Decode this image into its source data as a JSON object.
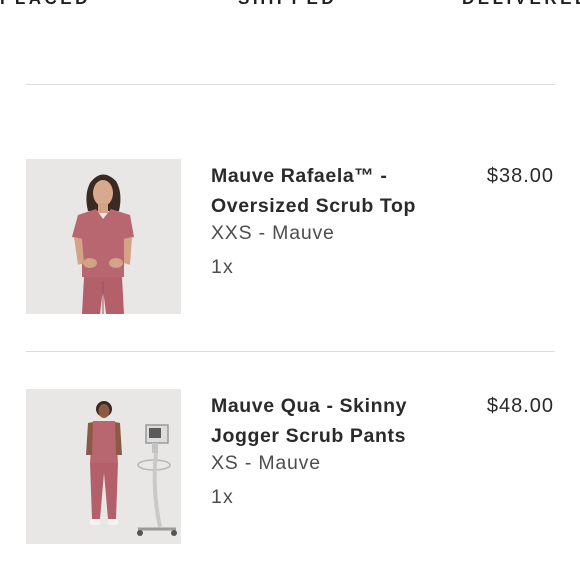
{
  "status_steps": [
    "PLACED",
    "SHIPPED",
    "DELIVERED"
  ],
  "items": [
    {
      "name": "Mauve Rafaela™ - Oversized Scrub Top",
      "variant": "XXS - Mauve",
      "quantity": "1x",
      "price": "$38.00",
      "image_icon": "scrub-top-photo-icon"
    },
    {
      "name": "Mauve Qua - Skinny Jogger Scrub Pants",
      "variant": "XS - Mauve",
      "quantity": "1x",
      "price": "$48.00",
      "image_icon": "scrub-pants-photo-icon"
    }
  ],
  "colors": {
    "mauve": "#b8666f",
    "photo_background": "#e7e6e4",
    "divider": "#dcdcdc"
  }
}
